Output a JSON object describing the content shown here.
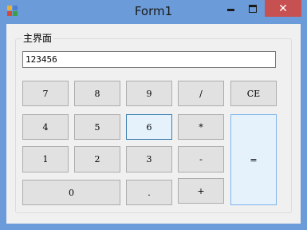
{
  "window": {
    "title": "Form1",
    "close_glyph": "✕",
    "icon": "app-window-icon"
  },
  "group": {
    "title": "主界面"
  },
  "display": {
    "value": "123456"
  },
  "buttons": {
    "b7": "7",
    "b8": "8",
    "b9": "9",
    "div": "/",
    "ce": "CE",
    "b4": "4",
    "b5": "5",
    "b6": "6",
    "mul": "*",
    "b1": "1",
    "b2": "2",
    "b3": "3",
    "sub": "-",
    "b0": "0",
    "dot": ".",
    "add": "+",
    "eq": "="
  },
  "colors": {
    "titlebar": "#6b9bd8",
    "close_button": "#c75050",
    "client_background": "#f0f0f0",
    "button_face": "#e1e1e1",
    "focused_button_border": "#3c7fb1",
    "equals_button_fill": "#e5f1fb"
  }
}
